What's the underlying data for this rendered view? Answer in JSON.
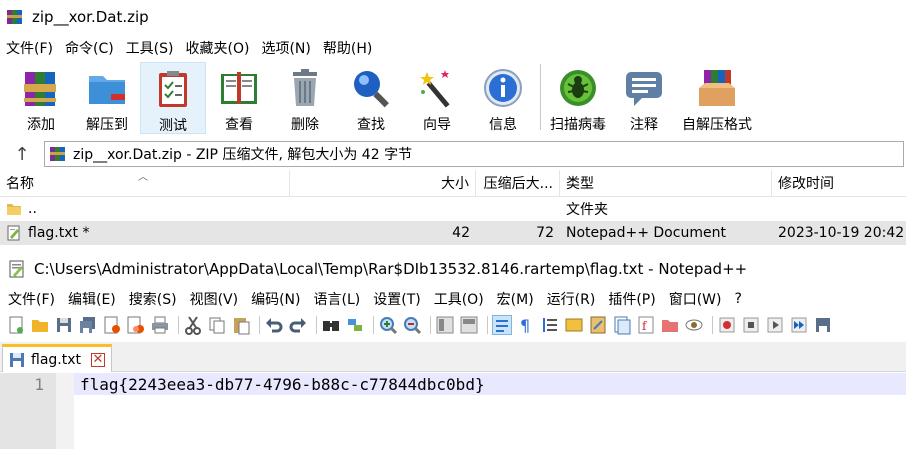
{
  "rar": {
    "title": "zip__xor.Dat.zip",
    "menu": [
      "文件(F)",
      "命令(C)",
      "工具(S)",
      "收藏夹(O)",
      "选项(N)",
      "帮助(H)"
    ],
    "toolbar": [
      {
        "label": "添加",
        "icon": "add-archive-icon"
      },
      {
        "label": "解压到",
        "icon": "extract-folder-icon"
      },
      {
        "label": "测试",
        "icon": "test-clipboard-icon"
      },
      {
        "label": "查看",
        "icon": "view-book-icon"
      },
      {
        "label": "删除",
        "icon": "trash-icon"
      },
      {
        "label": "查找",
        "icon": "magnifier-icon"
      },
      {
        "label": "向导",
        "icon": "magic-wand-icon"
      },
      {
        "label": "信息",
        "icon": "info-icon"
      },
      {
        "label": "扫描病毒",
        "icon": "virus-scan-icon"
      },
      {
        "label": "注释",
        "icon": "comment-icon"
      },
      {
        "label": "自解压格式",
        "icon": "sfx-box-icon"
      }
    ],
    "address": "zip__xor.Dat.zip - ZIP 压缩文件, 解包大小为 42 字节",
    "columns": {
      "name": "名称",
      "size": "大小",
      "packed": "压缩后大...",
      "type": "类型",
      "mtime": "修改时间"
    },
    "rows": [
      {
        "name": "..",
        "size": "",
        "packed": "",
        "type": "文件夹",
        "mtime": ""
      },
      {
        "name": "flag.txt *",
        "size": "42",
        "packed": "72",
        "type": "Notepad++ Document",
        "mtime": "2023-10-19 20:42"
      }
    ]
  },
  "notepad": {
    "title": "C:\\Users\\Administrator\\AppData\\Local\\Temp\\Rar$DIb13532.8146.rartemp\\flag.txt - Notepad++",
    "menu": [
      "文件(F)",
      "编辑(E)",
      "搜索(S)",
      "视图(V)",
      "编码(N)",
      "语言(L)",
      "设置(T)",
      "工具(O)",
      "宏(M)",
      "运行(R)",
      "插件(P)",
      "窗口(W)",
      "?"
    ],
    "tab_label": "flag.txt",
    "tab_close": "✕",
    "line_number": "1",
    "content": "flag{2243eea3-db77-4796-b88c-c77844dbc0bd}"
  },
  "colors": {
    "accent_tab": "#fabd23",
    "current_line": "#e8e8ff",
    "selected_row": "#e5e5e5",
    "toolbar_active": "#e5f1fb"
  }
}
